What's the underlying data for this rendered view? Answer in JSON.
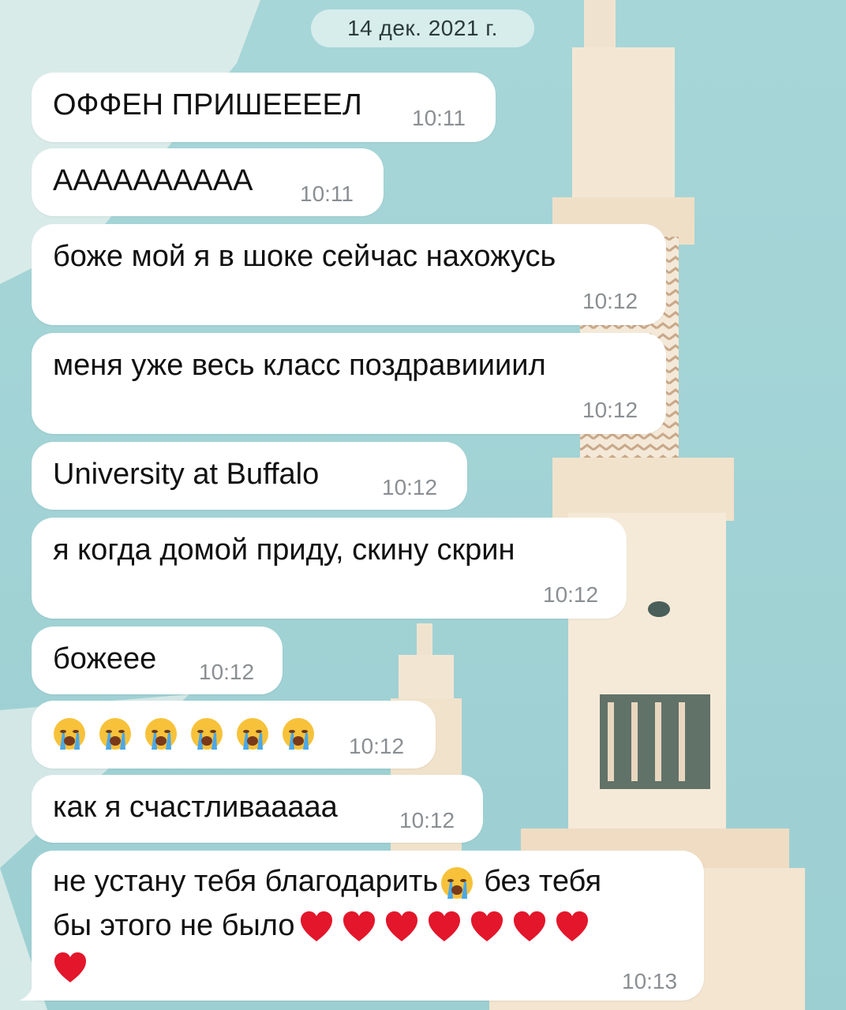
{
  "date_separator": "14 дек. 2021 г.",
  "messages": [
    {
      "text": "ОФФЕН ПРИШЕЕЕЕЛ",
      "time": "10:11"
    },
    {
      "text": "АААААААААА",
      "time": "10:11"
    },
    {
      "text": "боже мой я в шоке сейчас нахожусь",
      "time": "10:12"
    },
    {
      "text": "меня уже весь класс поздравиииил",
      "time": "10:12"
    },
    {
      "text": "University at Buffalo",
      "time": "10:12"
    },
    {
      "text": "я когда домой приду, скину скрин",
      "time": "10:12"
    },
    {
      "text": "божеее",
      "time": "10:12"
    },
    {
      "emoji": "loudly-crying-face",
      "count": 6,
      "time": "10:12"
    },
    {
      "text": "как я счастливааааа",
      "time": "10:12"
    },
    {
      "line1_a": "не устану тебя благодарить",
      "line1_b": "без тебя",
      "line2": "бы этого не было",
      "hearts": 8,
      "time": "10:13"
    }
  ],
  "colors": {
    "bubble": "#ffffff",
    "time": "#8a8f93",
    "sky": "#a9d5d6",
    "tower": "#f2e6d3"
  }
}
